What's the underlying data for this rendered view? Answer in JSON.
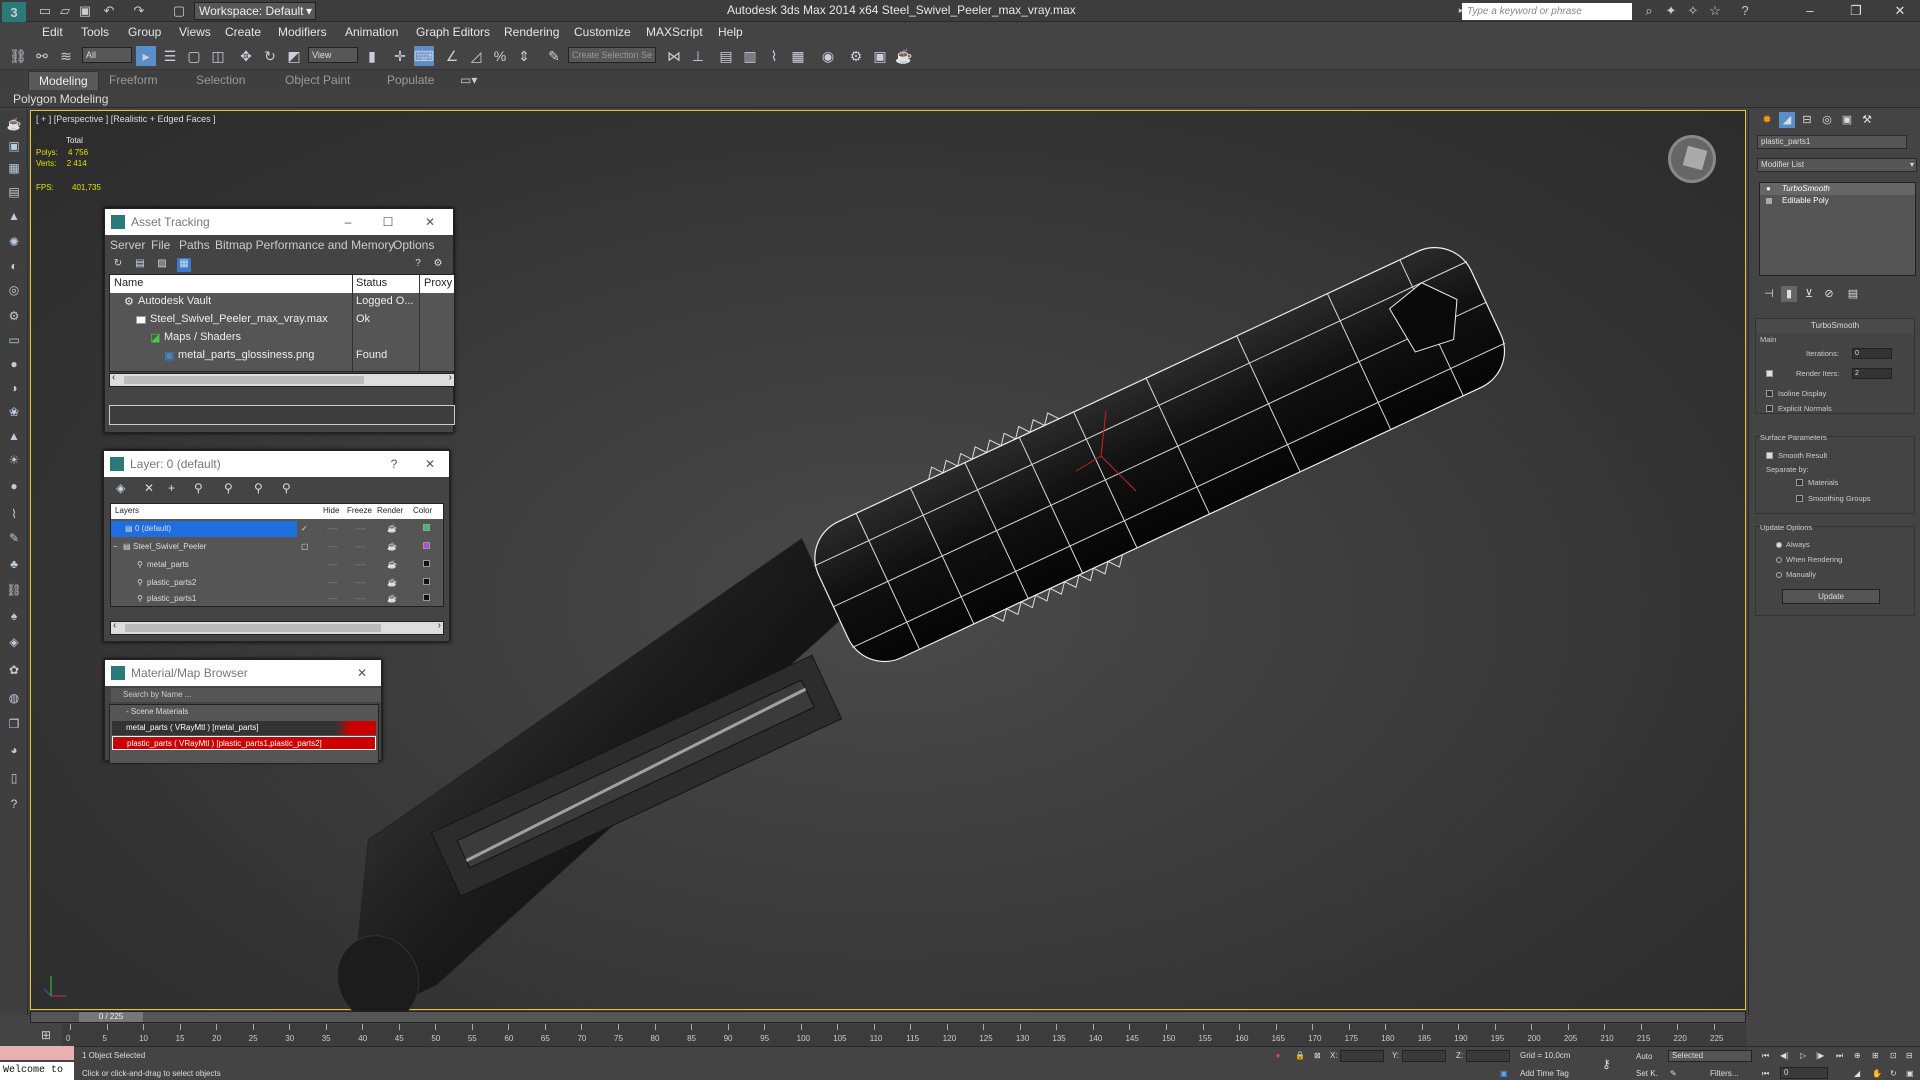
{
  "titlebar": {
    "workspace": "Workspace: Default",
    "window_title": "Autodesk 3ds Max  2014 x64     Steel_Swivel_Peeler_max_vray.max",
    "search_placeholder": "Type a keyword or phrase",
    "app_letter": "3"
  },
  "menu": [
    "Edit",
    "Tools",
    "Group",
    "Views",
    "Create",
    "Modifiers",
    "Animation",
    "Graph Editors",
    "Rendering",
    "Customize",
    "MAXScript",
    "Help"
  ],
  "toolbar": {
    "filter_value": "All",
    "refcoord_value": "View",
    "selection_set_placeholder": "Create Selection Se"
  },
  "ribbon": {
    "tabs": [
      "Modeling",
      "Freeform",
      "Selection",
      "Object Paint",
      "Populate"
    ],
    "sub_label": "Polygon Modeling"
  },
  "viewport": {
    "label": "[ + ] [Perspective ] [Realistic + Edged Faces ]",
    "stats_total": "Total",
    "polys_label": "Polys:",
    "polys_value": "4 756",
    "verts_label": "Verts:",
    "verts_value": "2 414",
    "fps_label": "FPS:",
    "fps_value": "401,735"
  },
  "asset_tracking": {
    "title": "Asset Tracking",
    "menu": [
      "Server",
      "File",
      "Paths",
      "Bitmap Performance and Memory",
      "Options"
    ],
    "columns": [
      "Name",
      "Status",
      "Proxy"
    ],
    "rows": [
      {
        "name": "Autodesk Vault",
        "status": "Logged O...",
        "proxy": ""
      },
      {
        "name": "Steel_Swivel_Peeler_max_vray.max",
        "status": "Ok",
        "proxy": ""
      },
      {
        "name": "Maps / Shaders",
        "status": "",
        "proxy": ""
      },
      {
        "name": "metal_parts_glossiness.png",
        "status": "Found",
        "proxy": ""
      }
    ]
  },
  "layer": {
    "title": "Layer: 0 (default)",
    "columns": [
      "Layers",
      "Hide",
      "Freeze",
      "Render",
      "Color"
    ],
    "rows": [
      {
        "name": "0 (default)",
        "hide": "----",
        "freeze": "----",
        "color": "#2fc46a"
      },
      {
        "name": "Steel_Swivel_Peeler",
        "hide": "----",
        "freeze": "----",
        "color": "#b04ad8"
      },
      {
        "name": "metal_parts",
        "hide": "----",
        "freeze": "----",
        "color": "#111111"
      },
      {
        "name": "plastic_parts2",
        "hide": "----",
        "freeze": "----",
        "color": "#111111"
      },
      {
        "name": "plastic_parts1",
        "hide": "----",
        "freeze": "----",
        "color": "#111111"
      }
    ]
  },
  "material_browser": {
    "title": "Material/Map Browser",
    "search_placeholder": "Search by Name ...",
    "group": "- Scene Materials",
    "items": [
      "metal_parts  ( VRayMtl ) [metal_parts]",
      "plastic_parts  ( VRayMtl ) [plastic_parts1,plastic_parts2]"
    ]
  },
  "command_panel": {
    "object_name": "plastic_parts1",
    "modifier_list": "Modifier List",
    "stack": [
      "TurboSmooth",
      "Editable Poly"
    ],
    "rollout_title": "TurboSmooth",
    "main_label": "Main",
    "iterations_label": "Iterations:",
    "iterations_value": "0",
    "render_iters_label": "Render Iters:",
    "render_iters_value": "2",
    "isoline": "Isoline Display",
    "explicit_normals": "Explicit Normals",
    "surface_params": "Surface Parameters",
    "smooth_result": "Smooth Result",
    "separate_by": "Separate by:",
    "materials": "Materials",
    "smoothing_groups": "Smoothing Groups",
    "update_options": "Update Options",
    "always": "Always",
    "when_rendering": "When Rendering",
    "manually": "Manually",
    "update_button": "Update"
  },
  "timeline": {
    "slider_label": "0 / 225",
    "ticks": [
      "0",
      "5",
      "10",
      "15",
      "20",
      "25",
      "30",
      "35",
      "40",
      "45",
      "50",
      "55",
      "60",
      "65",
      "70",
      "75",
      "80",
      "85",
      "90",
      "95",
      "100",
      "105",
      "110",
      "115",
      "120",
      "125",
      "130",
      "135",
      "140",
      "145",
      "150",
      "155",
      "160",
      "165",
      "170",
      "175",
      "180",
      "185",
      "190",
      "195",
      "200",
      "205",
      "210",
      "215",
      "220",
      "225"
    ]
  },
  "status": {
    "welcome": "Welcome to",
    "selected_count": "1 Object Selected",
    "prompt": "Click or click-and-drag to select objects",
    "x_label": "X:",
    "y_label": "Y:",
    "z_label": "Z:",
    "grid": "Grid = 10,0cm",
    "add_time_tag": "Add Time Tag",
    "auto": "Auto",
    "selected": "Selected",
    "set_k": "Set K.",
    "filters": "Filters...",
    "frame": "0"
  }
}
